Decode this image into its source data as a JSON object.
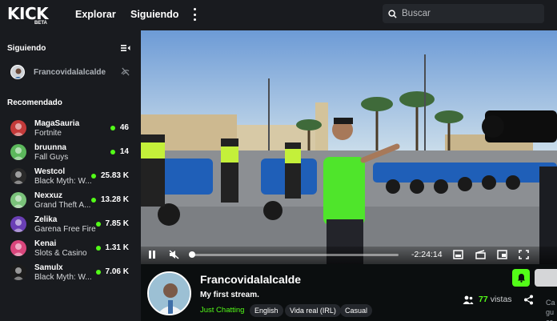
{
  "header": {
    "logo": "KICK",
    "logo_badge": "BETA",
    "nav": [
      "Explorar",
      "Siguiendo"
    ],
    "search_placeholder": "Buscar"
  },
  "sidebar": {
    "following_title": "Siguiendo",
    "following": [
      {
        "name": "Francovidalalcalde",
        "status": "offline"
      }
    ],
    "recommended_title": "Recomendado",
    "recommended": [
      {
        "name": "MagaSauria",
        "game": "Fortnite",
        "viewers": "46",
        "avatar_color": "#c43a3a"
      },
      {
        "name": "bruunna",
        "game": "Fall Guys",
        "viewers": "14",
        "avatar_color": "#5cb85c"
      },
      {
        "name": "Westcol",
        "game": "Black Myth: W...",
        "viewers": "25.83 K",
        "avatar_color": "#2a2a2a"
      },
      {
        "name": "Nexxuz",
        "game": "Grand Theft A...",
        "viewers": "13.28 K",
        "avatar_color": "#7ac27a"
      },
      {
        "name": "Zelika",
        "game": "Garena Free Fire",
        "viewers": "7.85 K",
        "avatar_color": "#6a3fb5"
      },
      {
        "name": "Kenai",
        "game": "Slots & Casino",
        "viewers": "1.31 K",
        "avatar_color": "#d9467c"
      },
      {
        "name": "Samulx",
        "game": "Black Myth: W...",
        "viewers": "7.06 K",
        "avatar_color": "#1c1c1c"
      }
    ]
  },
  "player": {
    "time": "-2:24:14",
    "progress": 0.0
  },
  "channel": {
    "name": "Francovidalalcalde",
    "title": "My first stream.",
    "category": "Just Chatting",
    "tags": [
      "English",
      "Vida real (IRL)",
      "Casual"
    ],
    "viewers": "77",
    "viewers_label": "vistas",
    "side_text": "Ca\ngu\ncc"
  },
  "colors": {
    "accent": "#53fc18",
    "bg": "#0b0e0f",
    "panel": "#191b1f"
  }
}
